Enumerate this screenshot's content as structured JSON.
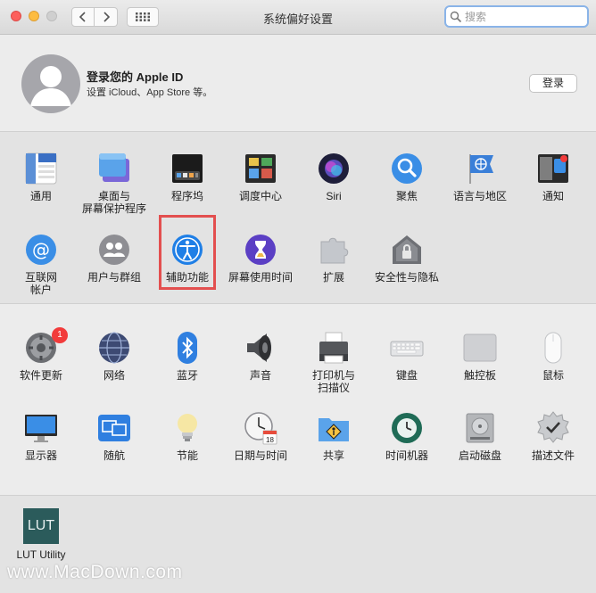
{
  "window": {
    "title": "系统偏好设置"
  },
  "search": {
    "placeholder": "搜索"
  },
  "account": {
    "title": "登录您的 Apple ID",
    "subtitle": "设置 iCloud、App Store 等。",
    "login_label": "登录"
  },
  "section1": [
    {
      "label": "通用",
      "icon": "general-icon"
    },
    {
      "label": "桌面与\n屏幕保护程序",
      "icon": "desktop-icon"
    },
    {
      "label": "程序坞",
      "icon": "dock-icon"
    },
    {
      "label": "调度中心",
      "icon": "mission-control-icon"
    },
    {
      "label": "Siri",
      "icon": "siri-icon"
    },
    {
      "label": "聚焦",
      "icon": "spotlight-icon"
    },
    {
      "label": "语言与地区",
      "icon": "language-region-icon"
    },
    {
      "label": "通知",
      "icon": "notifications-icon"
    },
    {
      "label": "互联网\n帐户",
      "icon": "internet-accounts-icon"
    },
    {
      "label": "用户与群组",
      "icon": "users-groups-icon"
    },
    {
      "label": "辅助功能",
      "icon": "accessibility-icon"
    },
    {
      "label": "屏幕使用时间",
      "icon": "screen-time-icon"
    },
    {
      "label": "扩展",
      "icon": "extensions-icon"
    },
    {
      "label": "安全性与隐私",
      "icon": "security-privacy-icon"
    }
  ],
  "section2": [
    {
      "label": "软件更新",
      "icon": "software-update-icon",
      "badge": "1"
    },
    {
      "label": "网络",
      "icon": "network-icon"
    },
    {
      "label": "蓝牙",
      "icon": "bluetooth-icon"
    },
    {
      "label": "声音",
      "icon": "sound-icon"
    },
    {
      "label": "打印机与\n扫描仪",
      "icon": "printers-scanners-icon"
    },
    {
      "label": "键盘",
      "icon": "keyboard-icon"
    },
    {
      "label": "触控板",
      "icon": "trackpad-icon"
    },
    {
      "label": "鼠标",
      "icon": "mouse-icon"
    },
    {
      "label": "显示器",
      "icon": "displays-icon"
    },
    {
      "label": "随航",
      "icon": "sidecar-icon"
    },
    {
      "label": "节能",
      "icon": "energy-saver-icon"
    },
    {
      "label": "日期与时间",
      "icon": "date-time-icon",
      "day": "18"
    },
    {
      "label": "共享",
      "icon": "sharing-icon"
    },
    {
      "label": "时间机器",
      "icon": "time-machine-icon"
    },
    {
      "label": "启动磁盘",
      "icon": "startup-disk-icon"
    },
    {
      "label": "描述文件",
      "icon": "profiles-icon"
    }
  ],
  "section3": [
    {
      "label": "LUT Utility",
      "icon": "lut-utility-icon",
      "icon_text": "LUT"
    }
  ],
  "watermark": "www.MacDown.com",
  "colors": {
    "highlight": "#e34f4f",
    "badge": "#f23b3b",
    "search_focus": "#8ab4e8"
  }
}
